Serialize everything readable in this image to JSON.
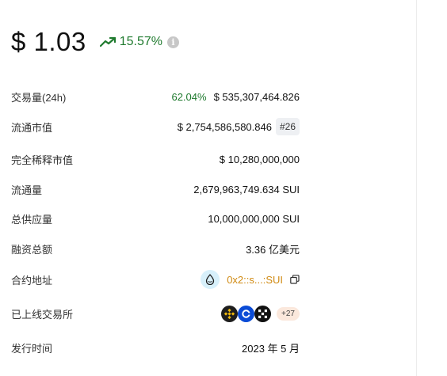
{
  "price": {
    "value": "$ 1.03",
    "change": "15.57%",
    "change_icon": "trend-up-icon",
    "info_icon": "info-icon"
  },
  "stats": {
    "volume": {
      "label": "交易量(24h)",
      "pct": "62.04%",
      "value": "$ 535,307,464.826"
    },
    "market_cap": {
      "label": "流通市值",
      "value": "$ 2,754,586,580.846",
      "rank": "#26"
    },
    "fdv": {
      "label": "完全稀释市值",
      "value": "$ 10,280,000,000"
    },
    "circulating": {
      "label": "流通量",
      "value": "2,679,963,749.634 SUI"
    },
    "total_supply": {
      "label": "总供应量",
      "value": "10,000,000,000 SUI"
    },
    "funding": {
      "label": "融资总额",
      "value": "3.36 亿美元"
    },
    "contract": {
      "label": "合约地址",
      "value": "0x2::s...:SUI",
      "logo": "sui-droplet-icon",
      "copy_icon": "copy-icon"
    },
    "exchanges": {
      "label": "已上线交易所",
      "icons": [
        "binance-icon",
        "coinbase-icon",
        "okx-icon"
      ],
      "more": "+27"
    },
    "launch": {
      "label": "发行时间",
      "value": "2023 年 5 月"
    }
  },
  "colors": {
    "positive": "#1f7a2e",
    "address": "#d08a12",
    "badge_bg": "#eef0f3",
    "more_bg": "#fbe8dc"
  }
}
